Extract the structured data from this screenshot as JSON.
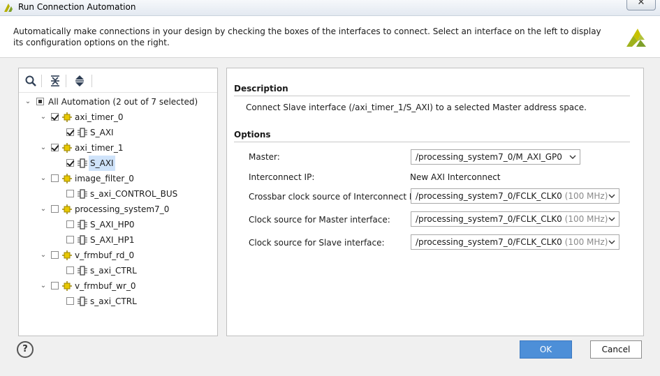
{
  "window": {
    "title": "Run Connection Automation",
    "close_glyph": "✕"
  },
  "header": {
    "description": "Automatically make connections in your design by checking the boxes of the interfaces to connect. Select an interface on the left to display its configuration options on the right.",
    "logo_icon": "xilinx-logo-icon"
  },
  "toolbar": {
    "icons": [
      "search-icon",
      "collapse-all-icon",
      "expand-all-icon"
    ]
  },
  "tree": {
    "root": {
      "label": "All Automation (2 out of 7 selected)",
      "state": "partial",
      "expanded": true
    },
    "items": [
      {
        "label": "axi_timer_0",
        "checked": true,
        "expanded": true,
        "children": [
          {
            "label": "S_AXI",
            "checked": true
          }
        ]
      },
      {
        "label": "axi_timer_1",
        "checked": true,
        "expanded": true,
        "children": [
          {
            "label": "S_AXI",
            "checked": true,
            "selected": true
          }
        ]
      },
      {
        "label": "image_filter_0",
        "checked": false,
        "expanded": true,
        "children": [
          {
            "label": "s_axi_CONTROL_BUS",
            "checked": false
          }
        ]
      },
      {
        "label": "processing_system7_0",
        "checked": false,
        "expanded": true,
        "children": [
          {
            "label": "S_AXI_HP0",
            "checked": false
          },
          {
            "label": "S_AXI_HP1",
            "checked": false
          }
        ]
      },
      {
        "label": "v_frmbuf_rd_0",
        "checked": false,
        "expanded": true,
        "children": [
          {
            "label": "s_axi_CTRL",
            "checked": false
          }
        ]
      },
      {
        "label": "v_frmbuf_wr_0",
        "checked": false,
        "expanded": true,
        "children": [
          {
            "label": "s_axi_CTRL",
            "checked": false
          }
        ]
      }
    ]
  },
  "details": {
    "description_title": "Description",
    "description_text": "Connect Slave interface (/axi_timer_1/S_AXI) to a selected Master address space.",
    "options_title": "Options",
    "master_label": "Master:",
    "master_value": "/processing_system7_0/M_AXI_GP0",
    "interconnect_label": "Interconnect IP:",
    "interconnect_value": "New AXI Interconnect",
    "crossbar_label": "Crossbar clock source of Interconnect IP:",
    "crossbar_value": "/processing_system7_0/FCLK_CLK0",
    "crossbar_freq": "(100 MHz)",
    "master_clock_label": "Clock source for Master interface:",
    "master_clock_value": "/processing_system7_0/FCLK_CLK0",
    "master_clock_freq": "(100 MHz)",
    "slave_clock_label": "Clock source for Slave interface:",
    "slave_clock_value": "/processing_system7_0/FCLK_CLK0",
    "slave_clock_freq": "(100 MHz)"
  },
  "footer": {
    "help_label": "?",
    "ok_label": "OK",
    "cancel_label": "Cancel"
  },
  "colors": {
    "accent": "#4d8fd8",
    "selection": "#cfe3fa",
    "ip_icon": "#d8c000"
  }
}
